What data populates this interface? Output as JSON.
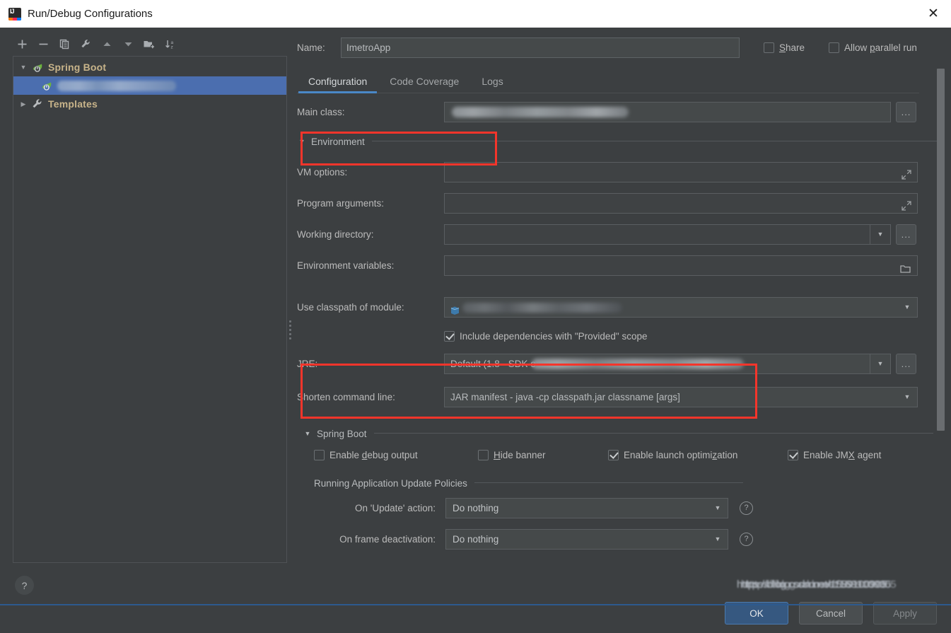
{
  "window": {
    "title": "Run/Debug Configurations",
    "app_icon": "intellij-idea-icon",
    "close_icon": "close-icon"
  },
  "toolbar": {
    "buttons": [
      {
        "name": "add-configuration-button",
        "icon": "plus-icon"
      },
      {
        "name": "remove-configuration-button",
        "icon": "minus-icon"
      },
      {
        "name": "copy-configuration-button",
        "icon": "copy-icon"
      },
      {
        "name": "edit-templates-button",
        "icon": "wrench-icon"
      },
      {
        "name": "move-up-button",
        "icon": "arrow-up-icon"
      },
      {
        "name": "move-down-button",
        "icon": "arrow-down-icon"
      },
      {
        "name": "new-folder-button",
        "icon": "folder-add-icon"
      },
      {
        "name": "sort-configurations-button",
        "icon": "sort-az-icon"
      }
    ]
  },
  "tree": {
    "nodes": [
      {
        "label": "Spring Boot",
        "expanded": true,
        "icon": "spring-boot-icon",
        "selected": false
      },
      {
        "label": "",
        "redacted": true,
        "icon": "spring-boot-icon",
        "selected": true
      },
      {
        "label": "Templates",
        "expanded": false,
        "icon": "wrench-icon",
        "selected": false
      }
    ]
  },
  "header": {
    "name_label": "Name:",
    "name_value": "ImetroApp",
    "share_label": "Share",
    "share_checked": false,
    "allow_parallel_label": "Allow parallel run",
    "allow_parallel_checked": false
  },
  "tabs": [
    {
      "label": "Configuration",
      "active": true
    },
    {
      "label": "Code Coverage",
      "active": false
    },
    {
      "label": "Logs",
      "active": false
    }
  ],
  "form": {
    "main_class_label": "Main class:",
    "main_class_value": "",
    "browse_label": "...",
    "environment_section": "Environment",
    "vm_options_label": "VM options:",
    "vm_options_value": "",
    "program_arguments_label": "Program arguments:",
    "program_arguments_value": "",
    "working_directory_label": "Working directory:",
    "working_directory_value": "",
    "environment_variables_label": "Environment variables:",
    "environment_variables_value": "",
    "use_classpath_label": "Use classpath of module:",
    "use_classpath_value": "",
    "include_provided_label": "Include dependencies with \"Provided\" scope",
    "include_provided_checked": true,
    "jre_label": "JRE:",
    "jre_value": "Default (1.8 - SDK o",
    "shorten_command_line_label": "Shorten command line:",
    "shorten_command_line_value": "JAR manifest - java -cp classpath.jar classname [args]"
  },
  "spring_boot": {
    "section_title": "Spring Boot",
    "checkboxes": [
      {
        "label": "Enable debug output",
        "checked": false,
        "mnemonic": "d"
      },
      {
        "label": "Hide banner",
        "checked": false,
        "mnemonic": "H"
      },
      {
        "label": "Enable launch optimization",
        "checked": true,
        "mnemonic": "z"
      },
      {
        "label": "Enable JMX agent",
        "checked": true,
        "mnemonic": "X"
      }
    ],
    "policies_title": "Running Application Update Policies",
    "update_action_label": "On 'Update' action:",
    "update_action_value": "Do nothing",
    "frame_deactivation_label": "On frame deactivation:",
    "frame_deactivation_value": "Do nothing",
    "help_icon": "question-circle-icon"
  },
  "footer": {
    "help_label": "?",
    "ok_label": "OK",
    "cancel_label": "Cancel",
    "apply_label": "Apply"
  },
  "watermark": {
    "text": "https://blog.csdn.net/1589100905"
  },
  "colors": {
    "background": "#3c3f41",
    "selection": "#4b6eaf",
    "accent": "#4a88c7",
    "highlight_red": "#f5352b",
    "ok_button": "#365880",
    "tree_label": "#c8b48a"
  }
}
